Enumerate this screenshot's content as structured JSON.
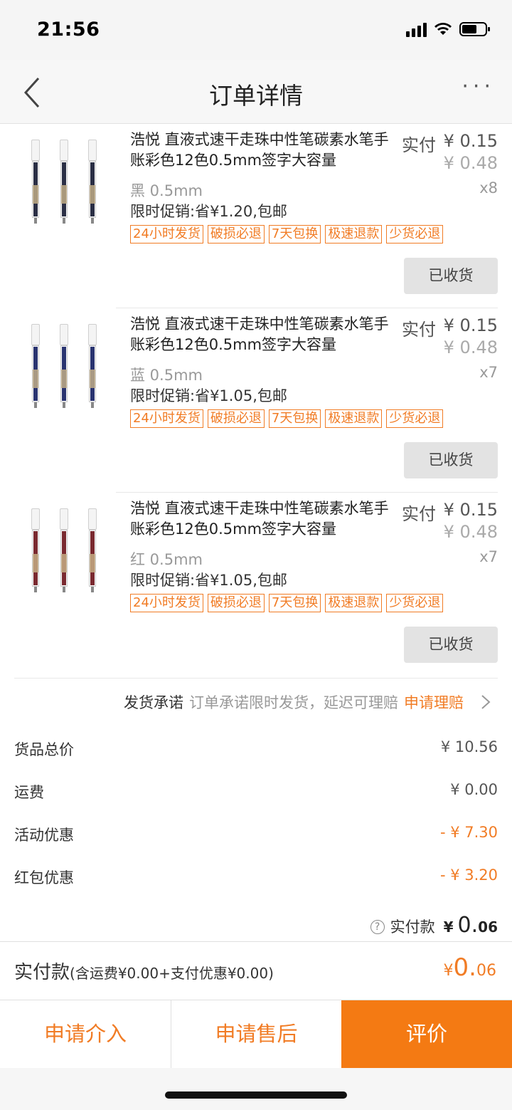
{
  "status_bar": {
    "time": "21:56"
  },
  "nav": {
    "title": "订单详情",
    "more": "···"
  },
  "items": [
    {
      "title": "浩悦 直液式速干走珠中性笔碳素水笔手账彩色12色0.5mm签字大容量",
      "price_label": "实付",
      "price": "¥ 0.15",
      "original_price": "¥ 0.48",
      "spec": "黑 0.5mm",
      "qty": "x8",
      "promo": "限时促销:省¥1.20,包邮",
      "tags": [
        "24小时发货",
        "破损必退",
        "7天包换",
        "极速退款",
        "少货必退"
      ],
      "button": "已收货",
      "ink_color": "#2b2f45"
    },
    {
      "title": "浩悦 直液式速干走珠中性笔碳素水笔手账彩色12色0.5mm签字大容量",
      "price_label": "实付",
      "price": "¥ 0.15",
      "original_price": "¥ 0.48",
      "spec": "蓝 0.5mm",
      "qty": "x7",
      "promo": "限时促销:省¥1.05,包邮",
      "tags": [
        "24小时发货",
        "破损必退",
        "7天包换",
        "极速退款",
        "少货必退"
      ],
      "button": "已收货",
      "ink_color": "#2a3470"
    },
    {
      "title": "浩悦 直液式速干走珠中性笔碳素水笔手账彩色12色0.5mm签字大容量",
      "price_label": "实付",
      "price": "¥ 0.15",
      "original_price": "¥ 0.48",
      "spec": "红 0.5mm",
      "qty": "x7",
      "promo": "限时促销:省¥1.05,包邮",
      "tags": [
        "24小时发货",
        "破损必退",
        "7天包换",
        "极速退款",
        "少货必退"
      ],
      "button": "已收货",
      "ink_color": "#7a2a30"
    }
  ],
  "promise": {
    "label": "发货承诺",
    "text": "订单承诺限时发货，延迟可理赔",
    "link": "申请理赔"
  },
  "fees": [
    {
      "label": "货品总价",
      "value": "¥ 10.56",
      "highlight": false
    },
    {
      "label": "运费",
      "value": "¥ 0.00",
      "highlight": false
    },
    {
      "label": "活动优惠",
      "value": "- ¥ 7.30",
      "highlight": true
    },
    {
      "label": "红包优惠",
      "value": "- ¥ 3.20",
      "highlight": true
    }
  ],
  "paid": {
    "help_icon": "?",
    "label": "实付款",
    "yen": "¥",
    "big": "0.",
    "small": "06"
  },
  "total": {
    "label": "实付款",
    "detail": "(含运费¥0.00+支付优惠¥0.00)",
    "yen": "¥",
    "big": "0.",
    "small": "06"
  },
  "actions": {
    "intervene": "申请介入",
    "after_sale": "申请售后",
    "review": "评价"
  },
  "colors": {
    "accent": "#f47a13",
    "tag": "#f17c25"
  }
}
